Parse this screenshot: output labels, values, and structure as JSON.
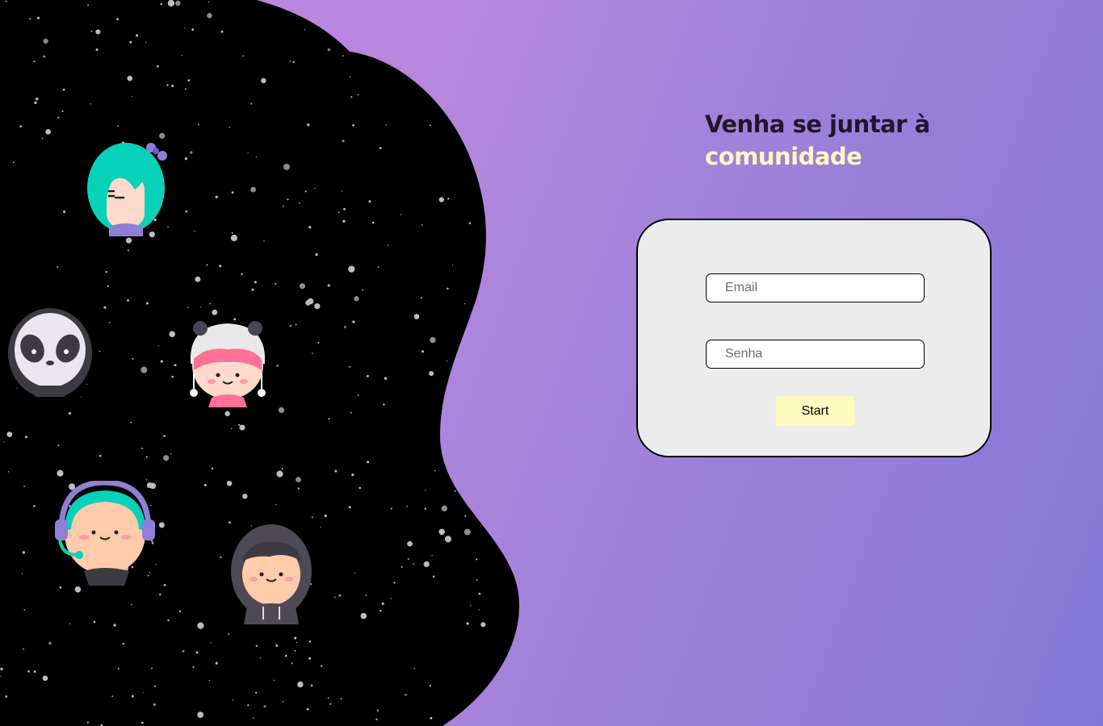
{
  "hero": {
    "line1": "Venha se juntar à",
    "line2": "comunidade"
  },
  "login": {
    "email_placeholder": "Email",
    "password_placeholder": "Senha",
    "start_label": "Start"
  },
  "avatars": [
    "girl-bow-avatar",
    "panda-avatar",
    "kitty-hat-avatar",
    "gamer-headset-avatar",
    "hoodie-avatar"
  ],
  "colors": {
    "space": "#000000",
    "gradient_start": "#c486de",
    "gradient_end": "#8377d6",
    "headline_dark": "#22152f",
    "headline_light": "#fff8c2",
    "card": "#ececec",
    "button": "#fefcbd"
  }
}
